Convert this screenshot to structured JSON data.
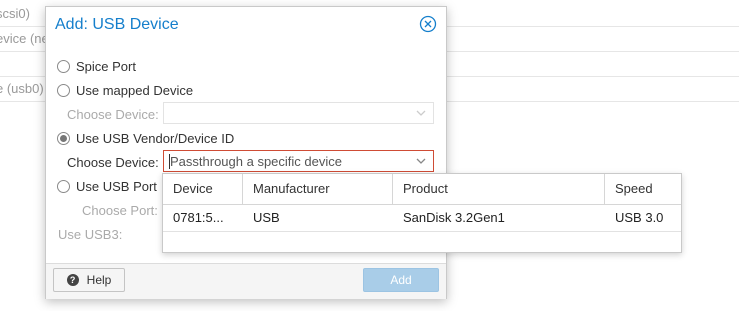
{
  "background": {
    "rows": [
      "scsi0)",
      "evice (ne",
      "",
      "",
      "e (usb0)"
    ]
  },
  "dialog": {
    "title": "Add: USB Device",
    "options": {
      "spice": "Spice Port",
      "mapped": "Use mapped Device",
      "vendor": "Use USB Vendor/Device ID",
      "port": "Use USB Port"
    },
    "selected_option": "vendor",
    "mapped_choose_label": "Choose Device:",
    "vendor_choose_label": "Choose Device:",
    "vendor_choose_placeholder": "Passthrough a specific device",
    "port_choose_label": "Choose Port:",
    "usb3_label": "Use USB3:",
    "help_label": "Help",
    "add_label": "Add"
  },
  "picker": {
    "columns": [
      "Device",
      "Manufacturer",
      "Product",
      "Speed"
    ],
    "rows": [
      {
        "device": "0781:5...",
        "manufacturer": "USB",
        "product": "SanDisk 3.2Gen1",
        "speed": "USB 3.0"
      }
    ]
  },
  "colors": {
    "accent": "#157fcc",
    "invalid_border": "#cf4c35",
    "add_button_disabled": "#a9cde8"
  }
}
